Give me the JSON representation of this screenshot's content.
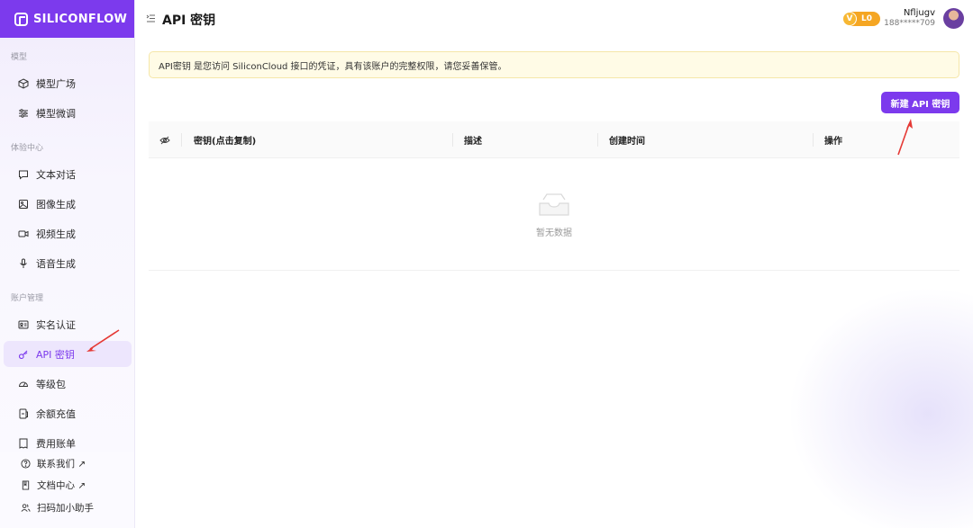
{
  "brand": {
    "name": "SILICONFLOW"
  },
  "sidebar": {
    "sections": [
      {
        "label": "模型"
      },
      {
        "label": "体验中心"
      },
      {
        "label": "账户管理"
      }
    ],
    "items": [
      {
        "label": "模型广场",
        "icon": "cube-icon"
      },
      {
        "label": "模型微调",
        "icon": "sliders-icon"
      },
      {
        "label": "文本对话",
        "icon": "chat-icon"
      },
      {
        "label": "图像生成",
        "icon": "image-icon"
      },
      {
        "label": "视频生成",
        "icon": "video-icon"
      },
      {
        "label": "语音生成",
        "icon": "mic-icon"
      },
      {
        "label": "实名认证",
        "icon": "id-card-icon"
      },
      {
        "label": "API 密钥",
        "icon": "key-icon",
        "active": true
      },
      {
        "label": "等级包",
        "icon": "gauge-icon"
      },
      {
        "label": "余额充值",
        "icon": "wallet-icon"
      },
      {
        "label": "费用账单",
        "icon": "bill-icon"
      }
    ],
    "bottom": [
      {
        "label": "联系我们 ↗",
        "icon": "help-icon"
      },
      {
        "label": "文档中心 ↗",
        "icon": "book-icon"
      },
      {
        "label": "扫码加小助手",
        "icon": "users-icon"
      }
    ]
  },
  "header": {
    "title": "API 密钥",
    "vip": {
      "badge": "V",
      "level": "L0"
    },
    "user": {
      "name": "Nfljugv",
      "phone": "188*****709"
    }
  },
  "notice": {
    "text": "API密钥 是您访问 SiliconCloud 接口的凭证，具有该账户的完整权限，请您妥善保管。"
  },
  "actions": {
    "new_key_label": "新建 API 密钥"
  },
  "table": {
    "columns": [
      "密钥(点击复制)",
      "描述",
      "创建时间",
      "操作"
    ],
    "empty_text": "暂无数据"
  },
  "colors": {
    "accent": "#7c3aed",
    "notice_bg": "#fffbe6",
    "vip_gold": "#f5a623",
    "annotation_arrow": "#e53935"
  }
}
